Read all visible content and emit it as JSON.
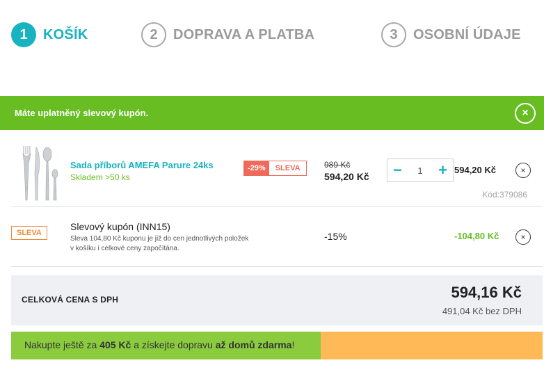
{
  "steps": [
    {
      "num": "1",
      "label": "KOŠÍK"
    },
    {
      "num": "2",
      "label": "DOPRAVA A PLATBA"
    },
    {
      "num": "3",
      "label": "OSOBNÍ ÚDAJE"
    }
  ],
  "alert": {
    "text": "Máte uplatněný slevový kupón.",
    "close_icon": "×"
  },
  "product": {
    "name": "Sada příborů AMEFA Parure 24ks",
    "stock": "Skladem >50 ks",
    "discount_pct": "-29%",
    "discount_label": "SLEVA",
    "old_price": "989 Kč",
    "new_price": "594,20 Kč",
    "qty": "1",
    "minus": "−",
    "plus": "+",
    "line_total": "594,20 Kč",
    "remove_icon": "×",
    "code": "Kód:379086"
  },
  "coupon": {
    "tag": "SLEVA",
    "title": "Slevový kupón (INN15)",
    "description": "Sleva 104,80 Kč kuponu je již do cen jednotlivých položek v košíku i celkové ceny započítána.",
    "pct": "-15%",
    "value": "-104,80 Kč",
    "remove_icon": "×"
  },
  "total": {
    "label": "CELKOVÁ CENA S DPH",
    "price": "594,16 Kč",
    "without_vat": "491,04 Kč bez DPH"
  },
  "shipping": {
    "prefix": "Nakupte ještě za ",
    "amount": "405 Kč",
    "middle": " a získejte dopravu ",
    "highlight": "až domů zdarma",
    "suffix": "!",
    "progress": 0.582
  },
  "colors": {
    "accent": "#17b3c0",
    "success": "#67bd22",
    "discount": "#ef6a5a",
    "coupon": "#f08a3b",
    "progress_fill": "#8bcb3e",
    "progress_bg": "#ffb957"
  }
}
